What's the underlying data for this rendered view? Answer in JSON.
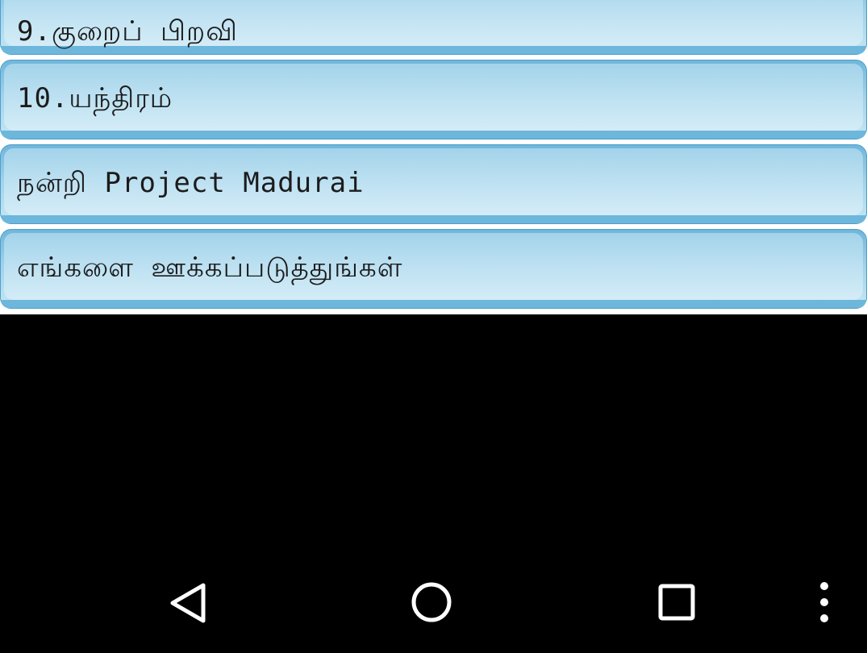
{
  "list": {
    "items": [
      {
        "label": "9.குறைப் பிறவி"
      },
      {
        "label": "10.யந்திரம்"
      },
      {
        "label": "நன்றி Project Madurai"
      },
      {
        "label": "எங்களை ஊக்கப்படுத்துங்கள்"
      }
    ]
  },
  "navbar": {
    "back_icon": "back-triangle-icon",
    "home_icon": "home-circle-icon",
    "recents_icon": "recents-square-icon",
    "menu_icon": "overflow-dots-icon"
  },
  "colors": {
    "item_gradient_top": "#6fb6db",
    "item_gradient_bottom": "#c6e7f4",
    "background": "#000000",
    "nav_icon": "#ffffff"
  }
}
